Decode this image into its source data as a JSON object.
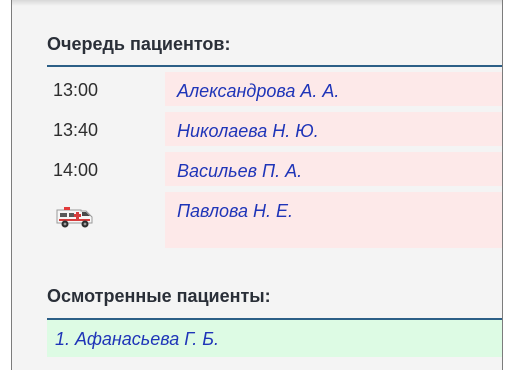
{
  "queue": {
    "title": "Очередь пациентов:",
    "patients": [
      {
        "time": "13:00",
        "name": "Александрова А. А."
      },
      {
        "time": "13:40",
        "name": "Николаева Н. Ю."
      },
      {
        "time": "14:00",
        "name": "Васильев П. А."
      },
      {
        "time": "",
        "icon": "ambulance-icon",
        "name": "Павлова Н. Е."
      }
    ]
  },
  "examined": {
    "title": "Осмотренные пациенты:",
    "patients": [
      "1. Афанасьева Г. Б."
    ]
  },
  "colors": {
    "header_rule": "#2c5f86",
    "queue_row_bg": "#fde9e9",
    "examined_row_bg": "#ddfbe4",
    "link_text": "#1f35b8"
  }
}
